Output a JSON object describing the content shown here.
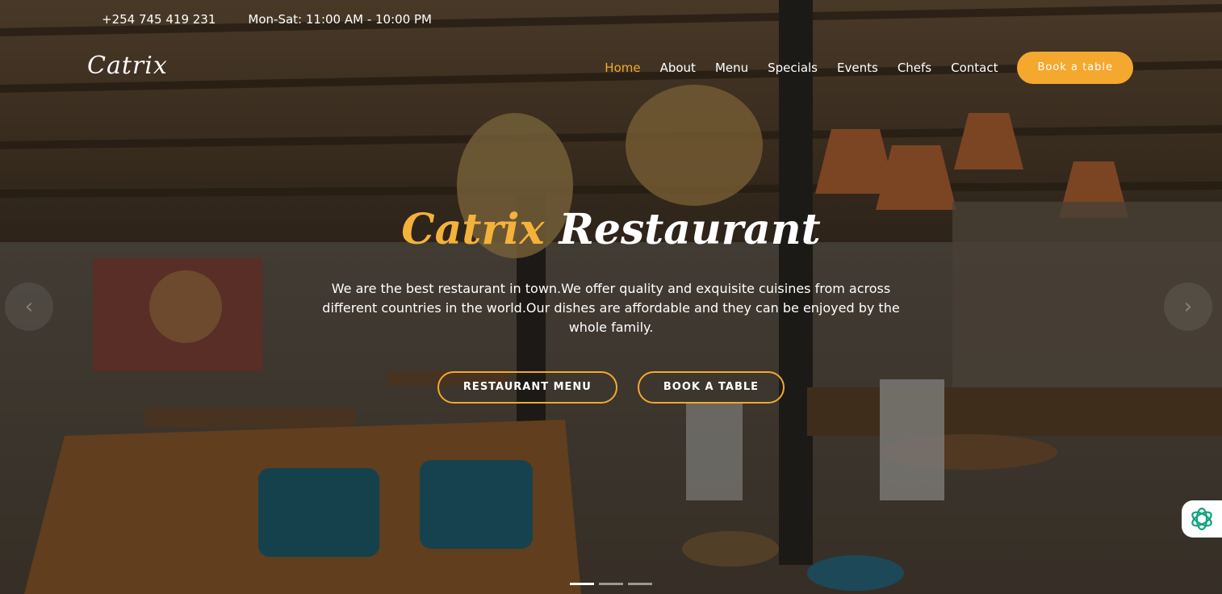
{
  "topbar": {
    "phone": "+254 745 419 231",
    "hours": "Mon-Sat: 11:00 AM - 10:00 PM"
  },
  "brand": {
    "logo": "Catrix"
  },
  "nav": {
    "items": [
      {
        "label": "Home",
        "active": true
      },
      {
        "label": "About"
      },
      {
        "label": "Menu"
      },
      {
        "label": "Specials"
      },
      {
        "label": "Events"
      },
      {
        "label": "Chefs"
      },
      {
        "label": "Contact"
      }
    ],
    "book_label": "Book a table"
  },
  "hero": {
    "title_accent": "Catrix",
    "title_rest": "Restaurant",
    "description": "We are the best restaurant in town.We offer quality and exquisite cuisines from across different countries in the world.Our dishes are affordable and they can be enjoyed by the whole family.",
    "cta_menu": "RESTAURANT MENU",
    "cta_book": "BOOK A TABLE"
  },
  "carousel": {
    "slides": 3,
    "active_index": 0
  },
  "colors": {
    "accent": "#f4a82e",
    "title_accent": "#f4b23b"
  },
  "icons": {
    "chat": "chatbot-icon",
    "prev": "chevron-left-icon",
    "next": "chevron-right-icon"
  }
}
